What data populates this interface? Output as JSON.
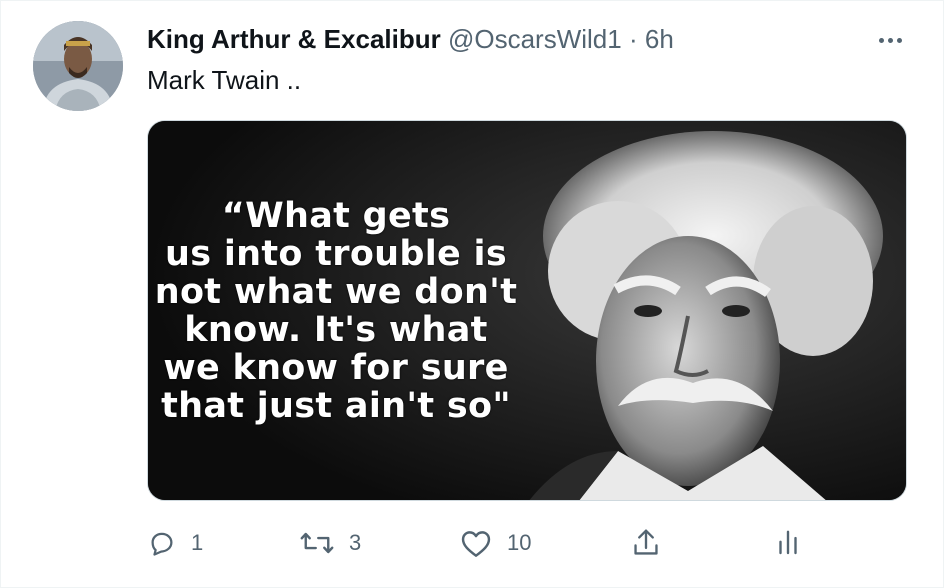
{
  "tweet": {
    "display_name": "King Arthur & Excalibur",
    "handle": "@OscarsWild1",
    "separator": "·",
    "time": "6h",
    "text": "Mark Twain ..",
    "media": {
      "quote_lines": [
        "“What gets",
        "us into trouble is",
        "not what we don't",
        "know. It's what",
        "we know for sure",
        "that just ain't so\""
      ]
    },
    "actions": {
      "reply_count": "1",
      "retweet_count": "3",
      "like_count": "10"
    }
  },
  "icons": [
    "more-icon",
    "reply-icon",
    "retweet-icon",
    "like-icon",
    "share-icon",
    "analytics-icon"
  ],
  "colors": {
    "text": "#0f1419",
    "secondary": "#536471",
    "border": "#cfd9de"
  }
}
